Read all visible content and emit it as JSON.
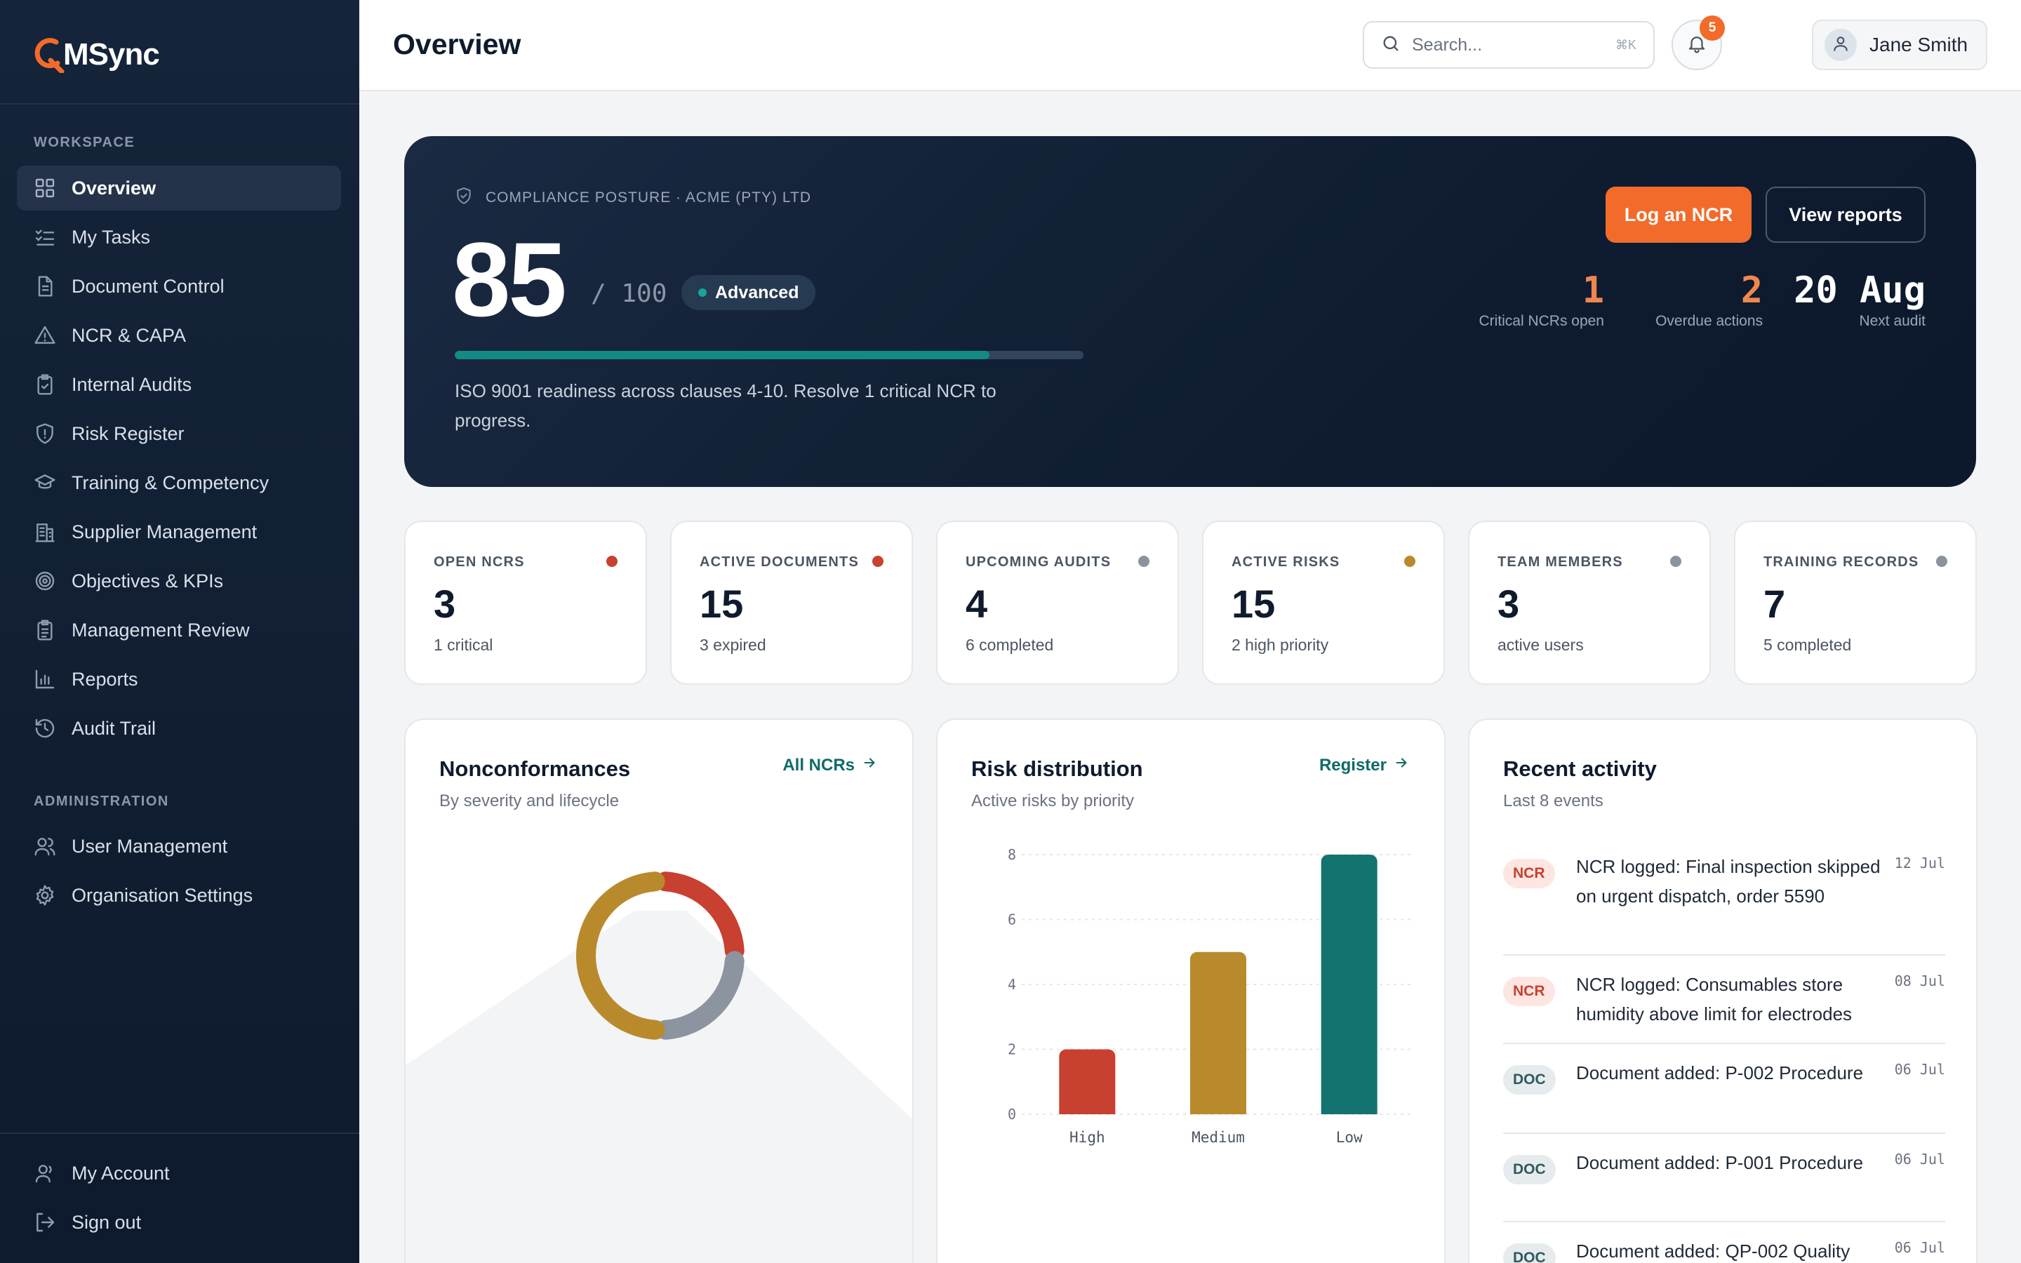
{
  "brand": {
    "name": "MSync"
  },
  "sidebar": {
    "workspace_label": "WORKSPACE",
    "admin_label": "ADMINISTRATION",
    "items": [
      {
        "label": "Overview",
        "icon": "grid-icon",
        "active": true
      },
      {
        "label": "My Tasks",
        "icon": "checklist-icon"
      },
      {
        "label": "Document Control",
        "icon": "document-icon"
      },
      {
        "label": "NCR & CAPA",
        "icon": "warning-icon"
      },
      {
        "label": "Internal Audits",
        "icon": "clipboard-check-icon"
      },
      {
        "label": "Risk Register",
        "icon": "shield-alert-icon"
      },
      {
        "label": "Training & Competency",
        "icon": "graduation-cap-icon"
      },
      {
        "label": "Supplier Management",
        "icon": "building-icon"
      },
      {
        "label": "Objectives & KPIs",
        "icon": "target-icon"
      },
      {
        "label": "Management Review",
        "icon": "clipboard-list-icon"
      },
      {
        "label": "Reports",
        "icon": "bar-chart-icon"
      },
      {
        "label": "Audit Trail",
        "icon": "history-icon"
      }
    ],
    "admin_items": [
      {
        "label": "User Management",
        "icon": "users-icon"
      },
      {
        "label": "Organisation Settings",
        "icon": "gear-icon"
      }
    ],
    "footer_items": [
      {
        "label": "My Account",
        "icon": "user-icon"
      },
      {
        "label": "Sign out",
        "icon": "sign-out-icon"
      }
    ]
  },
  "header": {
    "title": "Overview",
    "search_placeholder": "Search...",
    "search_shortcut": "⌘K",
    "notification_count": "5",
    "user_name": "Jane Smith"
  },
  "hero": {
    "kicker": "COMPLIANCE POSTURE · ACME (PTY) LTD",
    "score": "85",
    "score_max": "/ 100",
    "level": "Advanced",
    "progress": 0.85,
    "description": "ISO 9001 readiness across clauses 4-10. Resolve 1 critical NCR to progress.",
    "primary_button": "Log an NCR",
    "secondary_button": "View reports",
    "stats": [
      {
        "value": "1",
        "label": "Critical NCRs open",
        "color": "#f0874f"
      },
      {
        "value": "2",
        "label": "Overdue actions",
        "color": "#f0874f"
      },
      {
        "value": "20 Aug",
        "label": "Next audit",
        "color": "#ffffff"
      }
    ]
  },
  "kpis": [
    {
      "label": "OPEN NCRS",
      "value": "3",
      "sub": "1 critical",
      "dot": "#c8402f"
    },
    {
      "label": "ACTIVE DOCUMENTS",
      "value": "15",
      "sub": "3 expired",
      "dot": "#c8402f"
    },
    {
      "label": "UPCOMING AUDITS",
      "value": "4",
      "sub": "6 completed",
      "dot": "#8b939e"
    },
    {
      "label": "ACTIVE RISKS",
      "value": "15",
      "sub": "2 high priority",
      "dot": "#b98a2c"
    },
    {
      "label": "TEAM MEMBERS",
      "value": "3",
      "sub": "active users",
      "dot": "#8b939e"
    },
    {
      "label": "TRAINING RECORDS",
      "value": "7",
      "sub": "5 completed",
      "dot": "#8b939e"
    }
  ],
  "nonconformances": {
    "title": "Nonconformances",
    "subtitle": "By severity and lifecycle",
    "link": "All NCRs",
    "segments": [
      {
        "fraction": 0.25,
        "color": "#c8402f"
      },
      {
        "fraction": 0.25,
        "color": "#8c949f"
      },
      {
        "fraction": 0.5,
        "color": "#b98a2c"
      }
    ]
  },
  "risk": {
    "title": "Risk distribution",
    "subtitle": "Active risks by priority",
    "link": "Register"
  },
  "chart_data": {
    "type": "bar",
    "categories": [
      "High",
      "Medium",
      "Low"
    ],
    "values": [
      2,
      5,
      8
    ],
    "colors": [
      "#c8402f",
      "#b98a2c",
      "#13736f"
    ],
    "ylim": [
      0,
      8
    ],
    "yticks": [
      0,
      2,
      4,
      6,
      8
    ],
    "grid": true
  },
  "activity": {
    "title": "Recent activity",
    "subtitle": "Last 8 events",
    "items": [
      {
        "tag": "NCR",
        "kind": "ncr",
        "text": "NCR logged: Final inspection skipped on urgent dispatch, order 5590",
        "date": "12 Jul"
      },
      {
        "tag": "NCR",
        "kind": "ncr",
        "text": "NCR logged: Consumables store humidity above limit for electrodes",
        "date": "08 Jul"
      },
      {
        "tag": "DOC",
        "kind": "doc",
        "text": "Document added: P-002 Procedure",
        "date": "06 Jul"
      },
      {
        "tag": "DOC",
        "kind": "doc",
        "text": "Document added: P-001 Procedure",
        "date": "06 Jul"
      },
      {
        "tag": "DOC",
        "kind": "doc",
        "text": "Document added: QP-002 Quality",
        "date": "06 Jul"
      }
    ]
  }
}
